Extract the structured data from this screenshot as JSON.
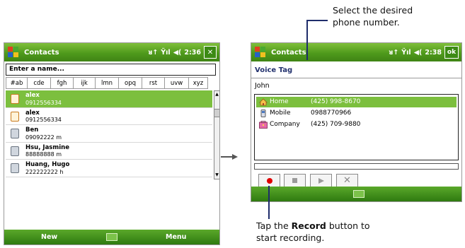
{
  "left_screen": {
    "app_title": "Contacts",
    "status_time": "2:36",
    "close_label": "✕",
    "search_placeholder": "Enter a name...",
    "tabs": [
      "#ab",
      "cde",
      "fgh",
      "ijk",
      "lmn",
      "opq",
      "rst",
      "uvw",
      "xyz"
    ],
    "contacts": [
      {
        "name": "alex",
        "phone": "0912556334",
        "selected": true
      },
      {
        "name": "alex",
        "phone": "0912556334",
        "selected": false
      },
      {
        "name": "Ben",
        "phone": "09092222  m",
        "selected": false
      },
      {
        "name": "Hsu, Jasmine",
        "phone": "88888888  m",
        "selected": false
      },
      {
        "name": "Huang, Hugo",
        "phone": "222222222  h",
        "selected": false
      }
    ],
    "softkeys": {
      "left": "New",
      "right": "Menu"
    }
  },
  "right_screen": {
    "app_title": "Contacts",
    "status_time": "2:38",
    "ok_label": "ok",
    "heading": "Voice Tag",
    "contact_name": "John",
    "numbers": [
      {
        "label": "Home",
        "number": "(425) 998-8670",
        "icon": "home-icon",
        "selected": true
      },
      {
        "label": "Mobile",
        "number": "0988770966",
        "icon": "mobile-phone-icon",
        "selected": false
      },
      {
        "label": "Company",
        "number": "(425) 709-9880",
        "icon": "company-icon",
        "selected": false
      }
    ],
    "controls": [
      "record-icon",
      "stop-icon",
      "play-icon",
      "delete-icon"
    ]
  },
  "callouts": {
    "top_line1": "Select the desired",
    "top_line2": "phone number.",
    "bottom_pre": "Tap the ",
    "bottom_bold": "Record",
    "bottom_post": " button to",
    "bottom_line2": "start recording."
  },
  "colors": {
    "title_green": "#4f9a1c",
    "selection_green": "#7cbf3e",
    "heading_blue": "#23326e",
    "callout_line": "#1f2d6b",
    "record_red": "#e00000"
  }
}
